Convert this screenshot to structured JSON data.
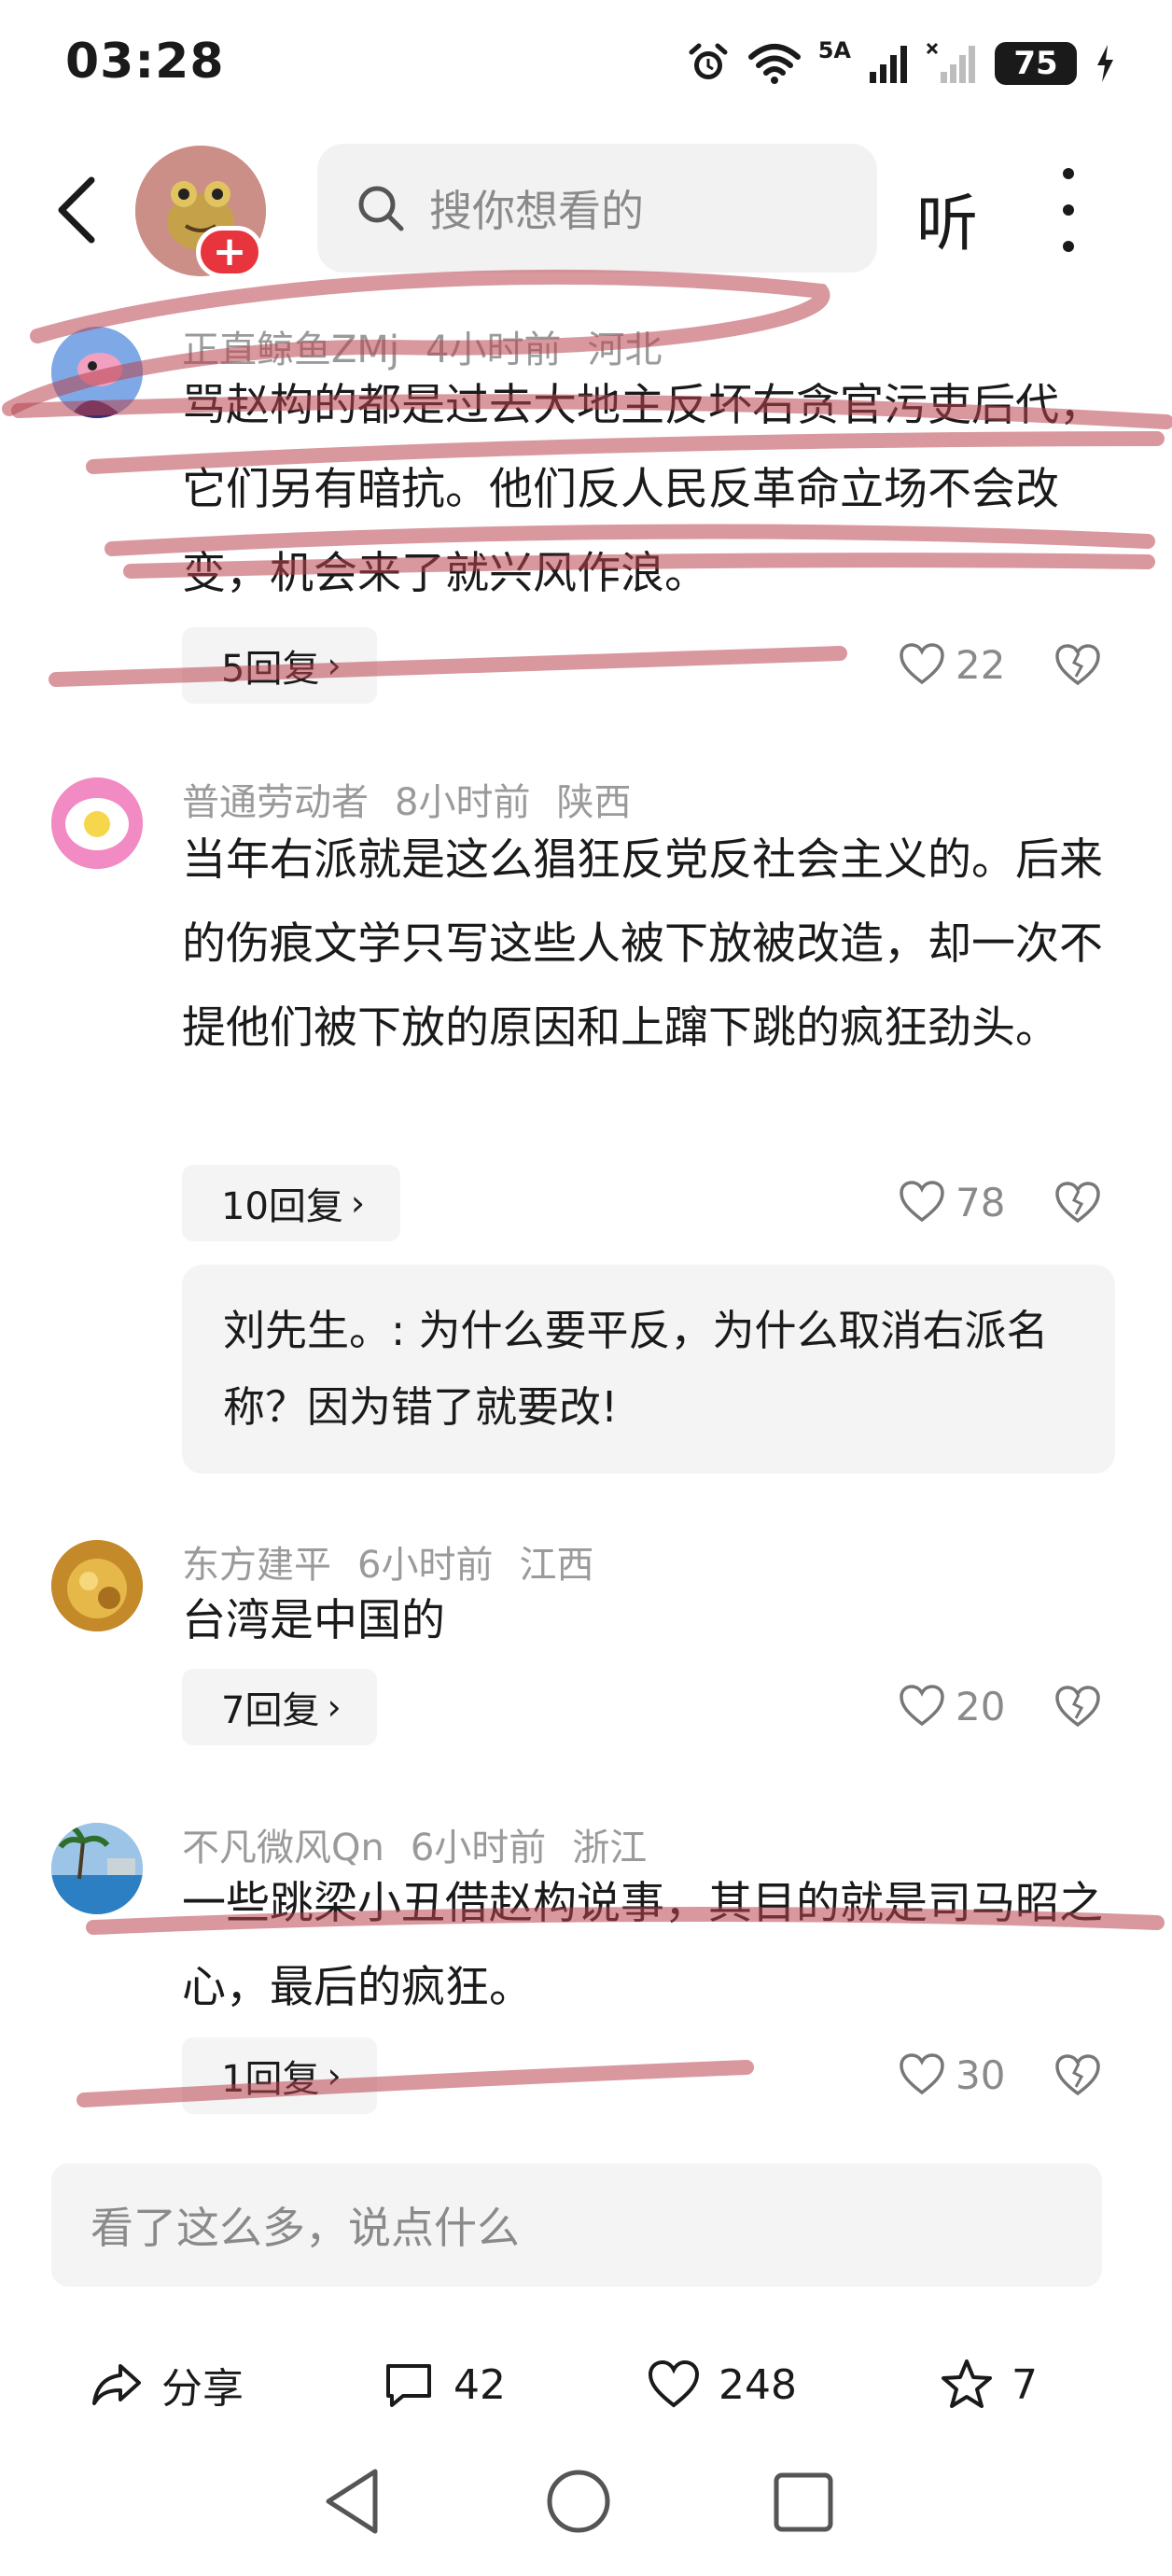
{
  "status_bar": {
    "time": "03:28",
    "network_label": "5A",
    "battery": "75"
  },
  "nav": {
    "search_placeholder": "搜你想看的",
    "listen_label": "听"
  },
  "comments": [
    {
      "user": "正直鲸鱼ZMj",
      "time": "4小时前",
      "location": "河北",
      "text": "骂赵构的都是过去大地主反坏右贪官污吏后代，它们另有暗抗。他们反人民反革命立场不会改变，机会来了就兴风作浪。",
      "replies_label": "5回复",
      "likes": "22"
    },
    {
      "user": "普通劳动者",
      "time": "8小时前",
      "location": "陕西",
      "text": "当年右派就是这么猖狂反党反社会主义的。后来的伤痕文学只写这些人被下放被改造，却一次不提他们被下放的原因和上蹿下跳的疯狂劲头。",
      "replies_label": "10回复",
      "likes": "78",
      "sub_reply": "刘先生。: 为什么要平反，为什么取消右派名称？因为错了就要改!"
    },
    {
      "user": "东方建平",
      "time": "6小时前",
      "location": "江西",
      "text": "台湾是中国的",
      "replies_label": "7回复",
      "likes": "20"
    },
    {
      "user": "不凡微风Qn",
      "time": "6小时前",
      "location": "浙江",
      "text": "一些跳梁小丑借赵构说事，其目的就是司马昭之心，最后的疯狂。",
      "replies_label": "1回复",
      "likes": "30"
    }
  ],
  "input_placeholder": "看了这么多，说点什么",
  "bottom_actions": {
    "share_label": "分享",
    "comments_count": "42",
    "likes_count": "248",
    "favorites_count": "7"
  },
  "colors": {
    "badge_red": "#e8353d",
    "scribble": "#b8434f",
    "muted_text": "#9a9a9a"
  }
}
